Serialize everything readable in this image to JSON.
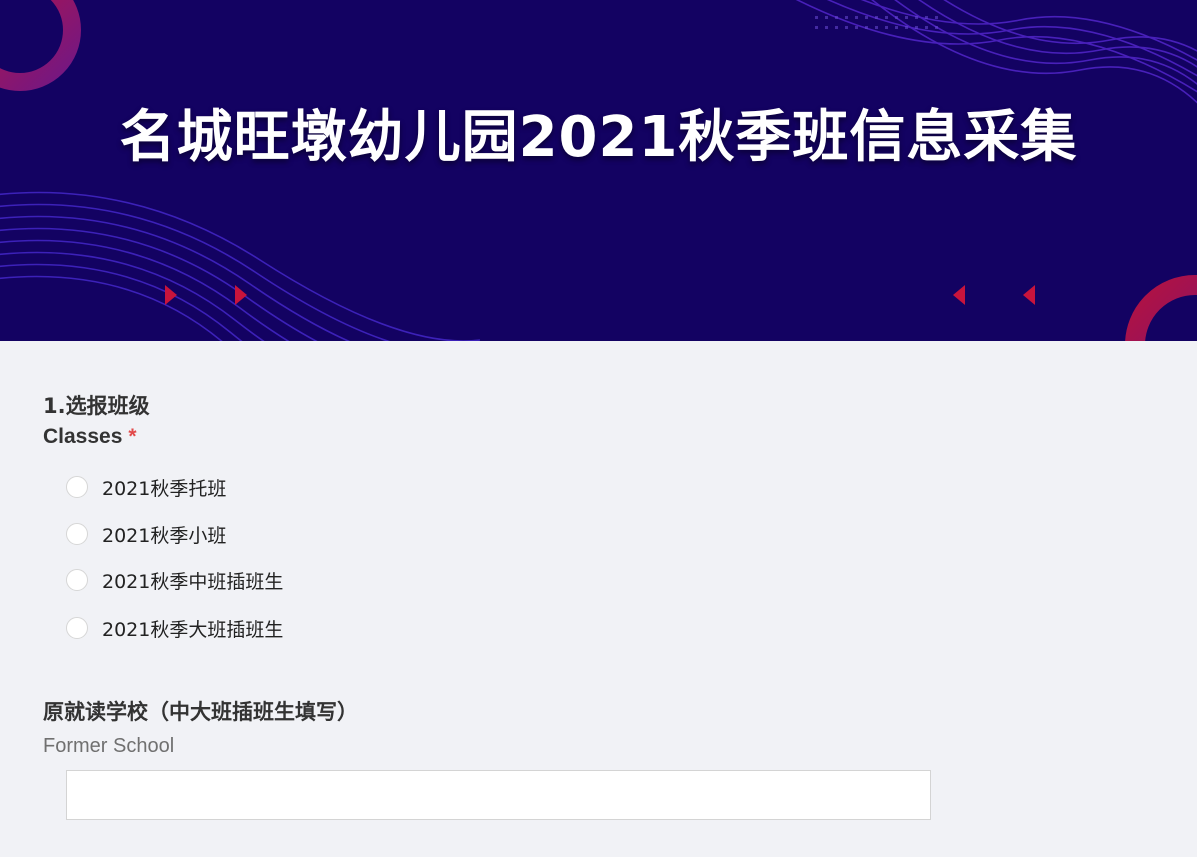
{
  "banner": {
    "title": "名城旺墩幼儿园2021秋季班信息采集"
  },
  "questions": {
    "classes": {
      "title": "1.选报班级",
      "subtitle": "Classes",
      "required_mark": "*",
      "options": [
        {
          "label": "2021秋季托班",
          "selected": false
        },
        {
          "label": "2021秋季小班",
          "selected": false
        },
        {
          "label": "2021秋季中班插班生",
          "selected": false
        },
        {
          "label": "2021秋季大班插班生",
          "selected": false
        }
      ]
    },
    "former_school": {
      "title": "原就读学校（中大班插班生填写）",
      "subtitle": "Former School",
      "value": "",
      "placeholder": ""
    }
  },
  "colors": {
    "banner_bg": "#130262",
    "page_bg": "#f1f2f6",
    "required": "#e24a4a",
    "accent_red": "#c8143c",
    "accent_purple": "#6a22d6"
  }
}
